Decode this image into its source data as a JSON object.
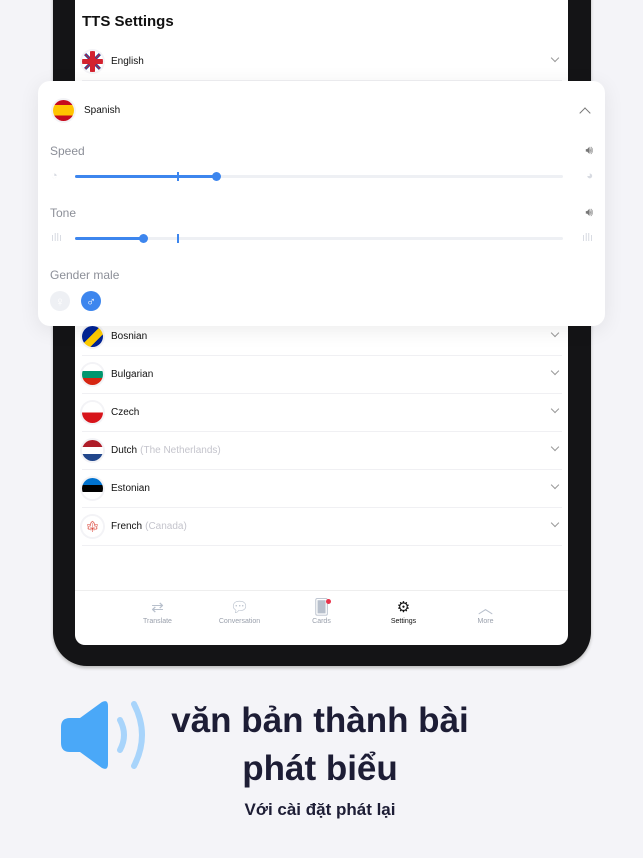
{
  "screen": {
    "title": "TTS Settings",
    "english": {
      "label": "English"
    },
    "expanded": {
      "language": "Spanish",
      "speed_label": "Speed",
      "speed_value": 0.29,
      "speed_default": 0.21,
      "tone_label": "Tone",
      "tone_value": 0.14,
      "tone_default": 0.21,
      "gender_label": "Gender male",
      "selected_gender": "male",
      "accent_color": "#3d86ee"
    },
    "languages": [
      {
        "label": "Bosnian",
        "sub": ""
      },
      {
        "label": "Bulgarian",
        "sub": ""
      },
      {
        "label": "Czech",
        "sub": ""
      },
      {
        "label": "Dutch",
        "sub": "(The Netherlands)"
      },
      {
        "label": "Estonian",
        "sub": ""
      },
      {
        "label": "French",
        "sub": "(Canada)"
      }
    ],
    "tabs": [
      {
        "label": "Translate",
        "icon": "translate-icon"
      },
      {
        "label": "Conversation",
        "icon": "conversation-icon"
      },
      {
        "label": "Cards",
        "icon": "cards-icon"
      },
      {
        "label": "Settings",
        "icon": "gear-icon",
        "active": true
      },
      {
        "label": "More",
        "icon": "chevron-up-icon"
      }
    ]
  },
  "promo": {
    "headline_1": "văn bản thành bài",
    "headline_2": "phát biểu",
    "subtitle": "Với cài đặt phát lại",
    "icon": "speaker-icon",
    "icon_color": "#4aa8f8"
  }
}
